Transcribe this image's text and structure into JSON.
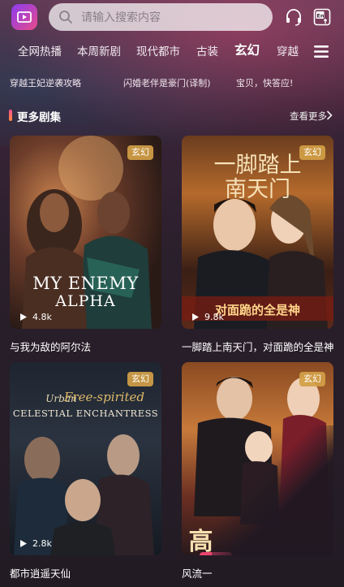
{
  "header": {
    "search_placeholder": "请输入搜索内容"
  },
  "tabs": [
    {
      "label": "全网热播"
    },
    {
      "label": "本周新剧"
    },
    {
      "label": "现代都市"
    },
    {
      "label": "古装"
    },
    {
      "label": "玄幻",
      "active": true
    },
    {
      "label": "穿越"
    }
  ],
  "ticker": [
    "穿越王妃逆袭攻略",
    "闪婚老伴是豪门(译制)",
    "宝贝，快答应!"
  ],
  "section": {
    "title": "更多剧集",
    "see_more": "查看更多"
  },
  "cards": [
    {
      "title": "与我为敌的阿尔法",
      "tag": "玄幻",
      "plays": "4.8k",
      "poster_text_1": "MY ENEMY",
      "poster_text_2": "ALPHA"
    },
    {
      "title": "一脚踏上南天门，对面跪的全是神",
      "tag": "玄幻",
      "plays": "9.8k",
      "poster_text_1": "一脚踏上",
      "poster_text_2": "南天门",
      "poster_text_3": "对面跪的全是神"
    },
    {
      "title": "都市逍遥天仙",
      "tag": "玄幻",
      "plays": "2.8k",
      "poster_text_1": "Urban",
      "poster_text_2": "Free-spirited",
      "poster_text_3": "CELESTIAL ENCHANTRESS"
    },
    {
      "title": "风流一",
      "tag": "玄幻",
      "poster_text_1": "高"
    }
  ],
  "colors": {
    "accent_pink": "#ff4f8e",
    "tag_gold": "#d2a046"
  }
}
